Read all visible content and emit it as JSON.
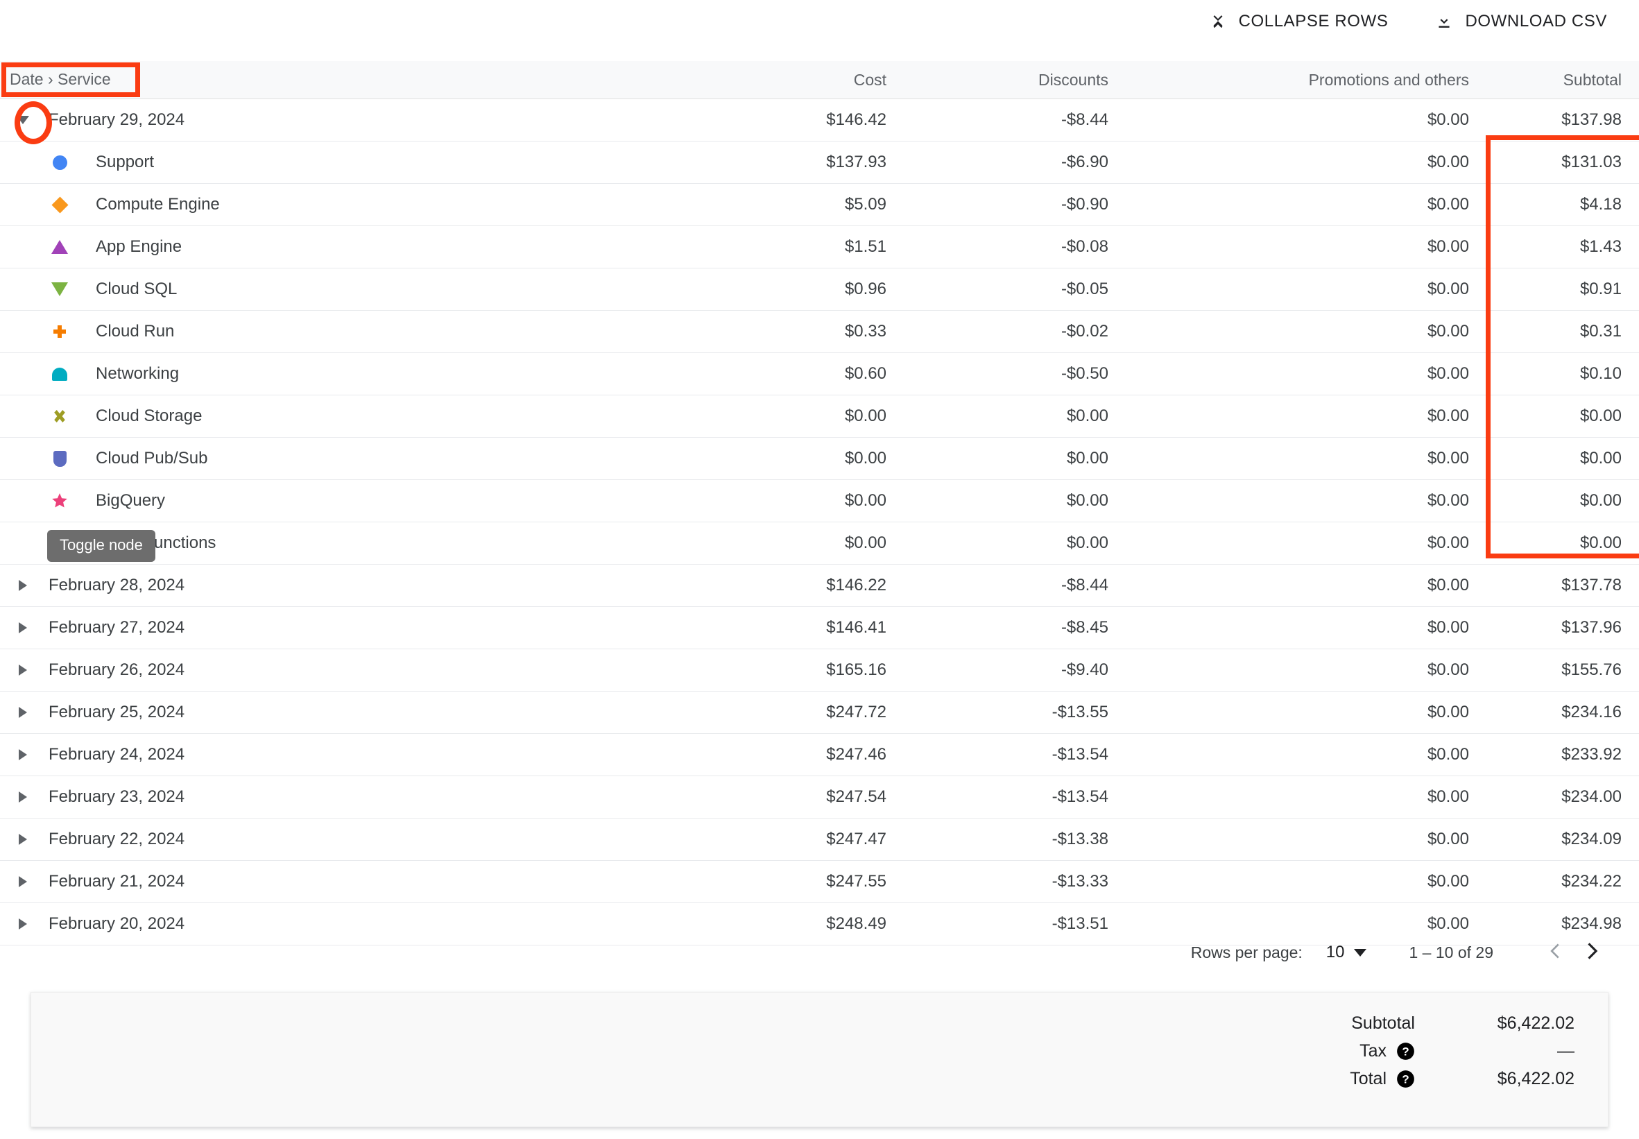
{
  "toolbar": {
    "collapse_label": "COLLAPSE ROWS",
    "collapse_icon": "collapse-rows-icon",
    "download_label": "DOWNLOAD CSV",
    "download_icon": "download-icon"
  },
  "table": {
    "headers": {
      "name": "Date › Service",
      "cost": "Cost",
      "discounts": "Discounts",
      "promotions": "Promotions and others",
      "subtotal": "Subtotal"
    },
    "expanded_group": {
      "date": "February 29, 2024",
      "cost": "$146.42",
      "discounts": "-$8.44",
      "promotions": "$0.00",
      "subtotal": "$137.98",
      "expanded": true
    },
    "services": [
      {
        "name": "Support",
        "marker": "circle",
        "color": "#4285f4",
        "cost": "$137.93",
        "discounts": "-$6.90",
        "promotions": "$0.00",
        "subtotal": "$131.03"
      },
      {
        "name": "Compute Engine",
        "marker": "diamond",
        "color": "#f9981d",
        "cost": "$5.09",
        "discounts": "-$0.90",
        "promotions": "$0.00",
        "subtotal": "$4.18"
      },
      {
        "name": "App Engine",
        "marker": "tri-up",
        "color": "#a142b8",
        "cost": "$1.51",
        "discounts": "-$0.08",
        "promotions": "$0.00",
        "subtotal": "$1.43"
      },
      {
        "name": "Cloud SQL",
        "marker": "tri-down",
        "color": "#7cb342",
        "cost": "$0.96",
        "discounts": "-$0.05",
        "promotions": "$0.00",
        "subtotal": "$0.91"
      },
      {
        "name": "Cloud Run",
        "marker": "cross",
        "color": "#f57c00",
        "cost": "$0.33",
        "discounts": "-$0.02",
        "promotions": "$0.00",
        "subtotal": "$0.31"
      },
      {
        "name": "Networking",
        "marker": "arch",
        "color": "#00acc1",
        "cost": "$0.60",
        "discounts": "-$0.50",
        "promotions": "$0.00",
        "subtotal": "$0.10"
      },
      {
        "name": "Cloud Storage",
        "marker": "x-cross",
        "color": "#9e9d24",
        "cost": "$0.00",
        "discounts": "$0.00",
        "promotions": "$0.00",
        "subtotal": "$0.00"
      },
      {
        "name": "Cloud Pub/Sub",
        "marker": "shield",
        "color": "#5c6bc0",
        "cost": "$0.00",
        "discounts": "$0.00",
        "promotions": "$0.00",
        "subtotal": "$0.00"
      },
      {
        "name": "BigQuery",
        "marker": "star",
        "color": "#ec407a",
        "cost": "$0.00",
        "discounts": "$0.00",
        "promotions": "$0.00",
        "subtotal": "$0.00"
      },
      {
        "name": "Cloud Functions",
        "marker": "square",
        "color": "#29b6f6",
        "cost": "$0.00",
        "discounts": "$0.00",
        "promotions": "$0.00",
        "subtotal": "$0.00"
      }
    ],
    "dates": [
      {
        "date": "February 28, 2024",
        "cost": "$146.22",
        "discounts": "-$8.44",
        "promotions": "$0.00",
        "subtotal": "$137.78"
      },
      {
        "date": "February 27, 2024",
        "cost": "$146.41",
        "discounts": "-$8.45",
        "promotions": "$0.00",
        "subtotal": "$137.96"
      },
      {
        "date": "February 26, 2024",
        "cost": "$165.16",
        "discounts": "-$9.40",
        "promotions": "$0.00",
        "subtotal": "$155.76"
      },
      {
        "date": "February 25, 2024",
        "cost": "$247.72",
        "discounts": "-$13.55",
        "promotions": "$0.00",
        "subtotal": "$234.16"
      },
      {
        "date": "February 24, 2024",
        "cost": "$247.46",
        "discounts": "-$13.54",
        "promotions": "$0.00",
        "subtotal": "$233.92"
      },
      {
        "date": "February 23, 2024",
        "cost": "$247.54",
        "discounts": "-$13.54",
        "promotions": "$0.00",
        "subtotal": "$234.00"
      },
      {
        "date": "February 22, 2024",
        "cost": "$247.47",
        "discounts": "-$13.38",
        "promotions": "$0.00",
        "subtotal": "$234.09"
      },
      {
        "date": "February 21, 2024",
        "cost": "$247.55",
        "discounts": "-$13.33",
        "promotions": "$0.00",
        "subtotal": "$234.22"
      },
      {
        "date": "February 20, 2024",
        "cost": "$248.49",
        "discounts": "-$13.51",
        "promotions": "$0.00",
        "subtotal": "$234.98"
      }
    ]
  },
  "tooltip": {
    "text": "Toggle node"
  },
  "paginator": {
    "rows_per_page_label": "Rows per page:",
    "rows_per_page_value": "10",
    "range": "1 – 10 of 29",
    "prev_icon": "chevron-left-icon",
    "next_icon": "chevron-right-icon"
  },
  "summary": {
    "subtotal_label": "Subtotal",
    "subtotal_value": "$6,422.02",
    "tax_label": "Tax",
    "tax_value": "—",
    "total_label": "Total",
    "total_value": "$6,422.02",
    "help_icon": "help-icon"
  },
  "annotations": {
    "accent_color": "#fa3c12",
    "header_box": "Date › Service",
    "twisty_ellipse": "expand-toggle",
    "subtotal_box": "Subtotal column"
  }
}
